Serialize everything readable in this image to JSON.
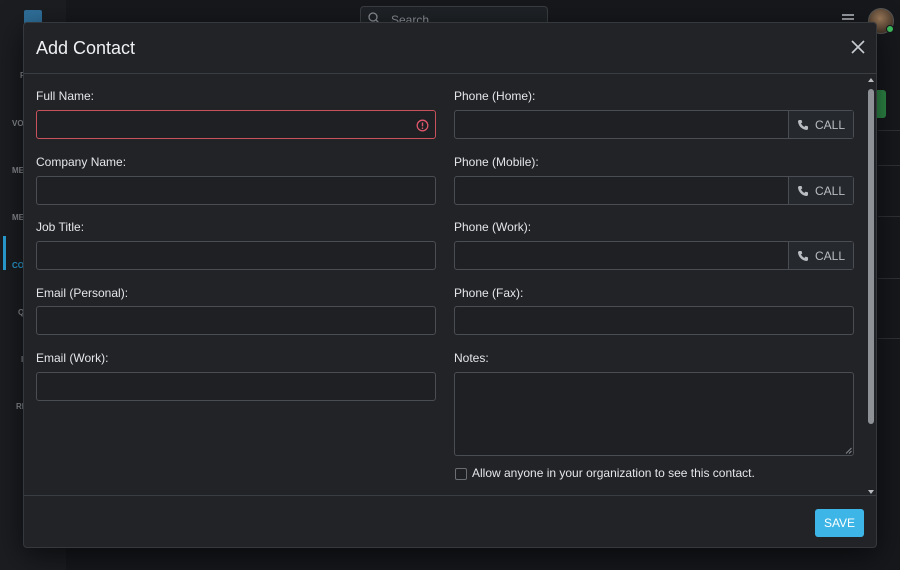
{
  "background": {
    "search_placeholder": "Search",
    "nav_labels": [
      "F",
      "VO",
      "ME",
      "ME",
      "CO",
      "Q",
      "I",
      "RE"
    ]
  },
  "dialog": {
    "title": "Add Contact",
    "fields_left": [
      {
        "label": "Full Name:",
        "value": "",
        "error": true
      },
      {
        "label": "Company Name:",
        "value": ""
      },
      {
        "label": "Job Title:",
        "value": ""
      },
      {
        "label": "Email (Personal):",
        "value": ""
      },
      {
        "label": "Email (Work):",
        "value": ""
      }
    ],
    "fields_right": [
      {
        "label": "Phone (Home):",
        "value": "",
        "call_label": "CALL"
      },
      {
        "label": "Phone (Mobile):",
        "value": "",
        "call_label": "CALL"
      },
      {
        "label": "Phone (Work):",
        "value": "",
        "call_label": "CALL"
      },
      {
        "label": "Phone (Fax):",
        "value": ""
      }
    ],
    "notes_label": "Notes:",
    "notes_value": "",
    "share_checkbox": {
      "label": "Allow anyone in your organization to see this contact.",
      "checked": false
    },
    "save_label": "SAVE",
    "colors": {
      "accent": "#3db5e6",
      "error": "#c7525c",
      "online": "#3fbf5f"
    }
  }
}
